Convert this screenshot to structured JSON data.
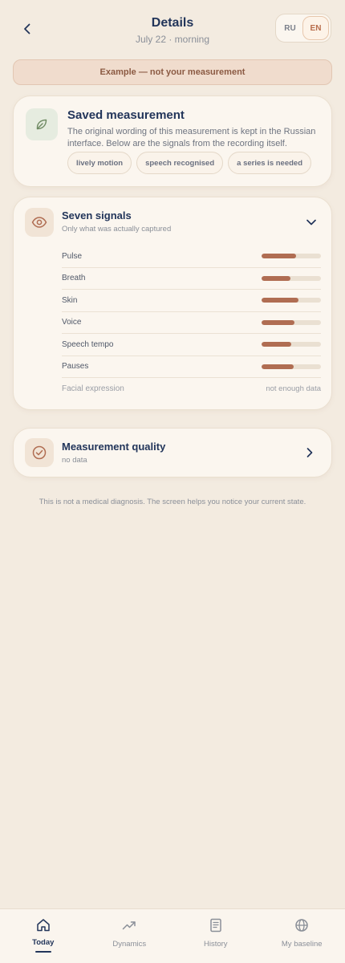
{
  "header": {
    "title": "Details",
    "subtitle": "July 22 · morning",
    "back_icon": "chevron-left-icon",
    "languages": [
      {
        "label": "RU",
        "active": false
      },
      {
        "label": "EN",
        "active": true
      }
    ]
  },
  "banner": {
    "text": "Example — not your measurement"
  },
  "saved": {
    "icon": "leaf-icon",
    "title": "Saved measurement",
    "description": "The original wording of this measurement is kept in the Russian interface. Below are the signals from the recording itself.",
    "chips": [
      "lively motion",
      "speech recognised",
      "a series is needed"
    ]
  },
  "signals": {
    "icon": "eye-icon",
    "title": "Seven signals",
    "subtitle": "Only what was actually captured",
    "items": [
      {
        "name": "Pulse",
        "level": 0.58
      },
      {
        "name": "Breath",
        "level": 0.49
      },
      {
        "name": "Skin",
        "level": 0.62
      },
      {
        "name": "Voice",
        "level": 0.56
      },
      {
        "name": "Speech tempo",
        "level": 0.5
      },
      {
        "name": "Pauses",
        "level": 0.54
      },
      {
        "name": "Facial expression",
        "note": "not enough data"
      }
    ]
  },
  "quality": {
    "icon": "check-circle-icon",
    "title": "Measurement quality",
    "subtitle": "no data"
  },
  "disclaimer": "This is not a medical diagnosis. The screen helps you notice your current state.",
  "tabs": [
    {
      "label": "Today",
      "icon": "home-icon",
      "active": true
    },
    {
      "label": "Dynamics",
      "icon": "trend-icon",
      "active": false
    },
    {
      "label": "History",
      "icon": "book-icon",
      "active": false
    },
    {
      "label": "My baseline",
      "icon": "globe-icon",
      "active": false
    }
  ],
  "colors": {
    "background": "#f3ebe0",
    "accent": "#b06d52",
    "navy": "#22355a"
  }
}
